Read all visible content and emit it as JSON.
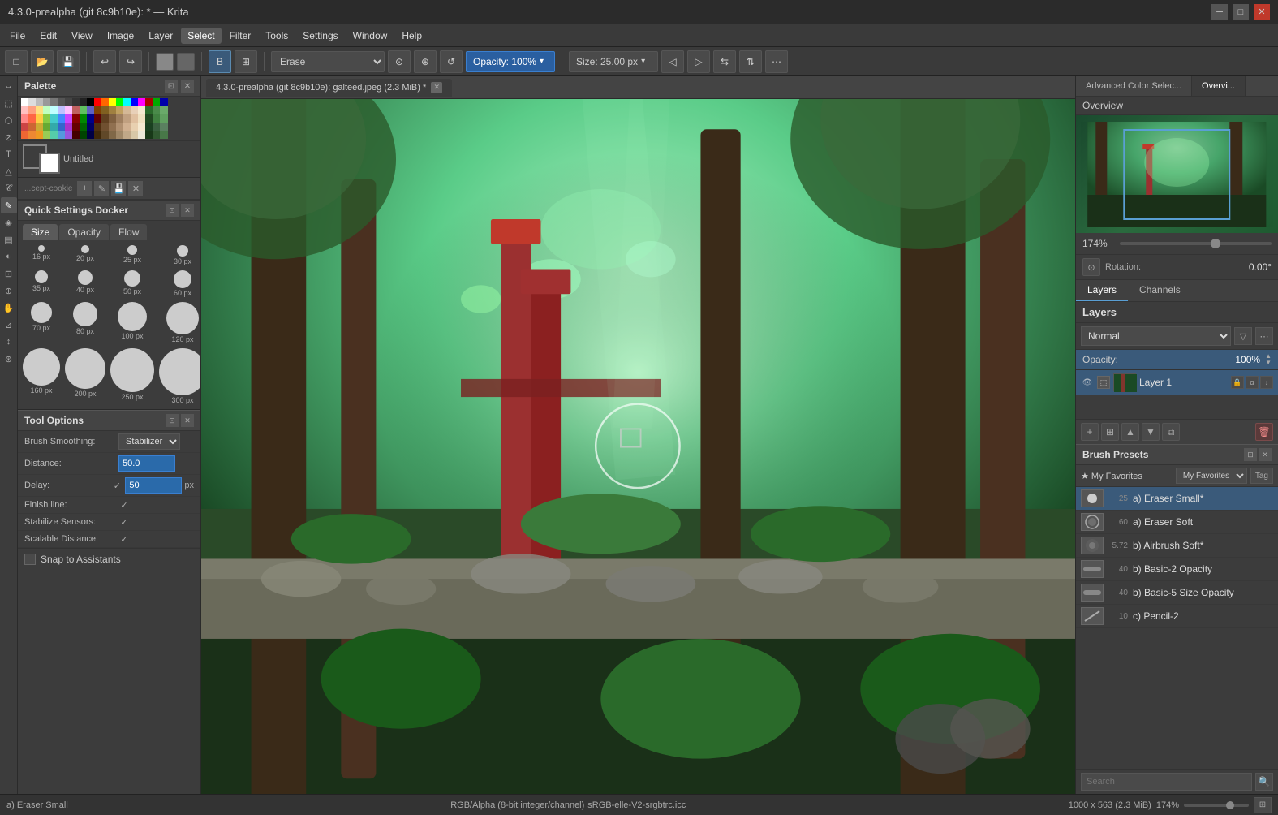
{
  "window": {
    "title": "4.3.0-prealpha (git 8c9b10e): * — Krita",
    "controls": [
      "minimize",
      "maximize",
      "close"
    ]
  },
  "menu": {
    "items": [
      "File",
      "Edit",
      "View",
      "Image",
      "Layer",
      "Select",
      "Filter",
      "Tools",
      "Settings",
      "Window",
      "Help"
    ]
  },
  "toolbar": {
    "erase_label": "Erase",
    "opacity_label": "Opacity: 100%",
    "size_label": "Size: 25.00 px"
  },
  "canvas_tab": {
    "title": "4.3.0-prealpha (git 8c9b10e): galteed.jpeg (2.3 MiB) *"
  },
  "left_panel": {
    "palette_title": "Palette",
    "fg_color": "#3d3d3d",
    "bg_color": "#ffffff",
    "resource_label": "Untitled",
    "resource_sub": "...cept-cookie",
    "quick_settings_title": "Quick Settings Docker",
    "tabs": [
      "Size",
      "Opacity",
      "Flow"
    ],
    "active_tab": "Size",
    "brush_sizes": [
      {
        "size": 8,
        "label": "16 px"
      },
      {
        "size": 10,
        "label": "20 px"
      },
      {
        "size": 12,
        "label": "25 px"
      },
      {
        "size": 14,
        "label": "30 px"
      },
      {
        "size": 16,
        "label": "35 px"
      },
      {
        "size": 18,
        "label": "40 px"
      },
      {
        "size": 20,
        "label": "50 px"
      },
      {
        "size": 22,
        "label": "60 px"
      },
      {
        "size": 26,
        "label": "70 px"
      },
      {
        "size": 30,
        "label": "80 px"
      },
      {
        "size": 36,
        "label": "100 px"
      },
      {
        "size": 40,
        "label": "120 px"
      },
      {
        "size": 46,
        "label": "160 px"
      },
      {
        "size": 50,
        "label": "200 px"
      },
      {
        "size": 54,
        "label": "250 px"
      },
      {
        "size": 58,
        "label": "300 px"
      }
    ],
    "tool_options_title": "Tool Options",
    "brush_smoothing_label": "Brush Smoothing:",
    "brush_smoothing_value": "Stabilizer",
    "distance_label": "Distance:",
    "distance_value": "50.0",
    "delay_label": "Delay:",
    "delay_value": "50",
    "delay_unit": "px",
    "finish_line_label": "Finish line:",
    "finish_line_checked": true,
    "stabilize_sensors_label": "Stabilize Sensors:",
    "stabilize_sensors_checked": true,
    "scalable_distance_label": "Scalable Distance:",
    "scalable_distance_checked": true,
    "snap_assistants_label": "Snap to Assistants"
  },
  "right_panel": {
    "advanced_color_select_tab": "Advanced Color Selec...",
    "overview_tab": "Overvi...",
    "overview_label": "Overview",
    "zoom_percent": "174%",
    "rotation_label": "Rotation:",
    "rotation_value": "0.00°",
    "layers_tab": "Layers",
    "channels_tab": "Channels",
    "layers_title": "Layers",
    "blend_mode": "Normal",
    "opacity_label": "Opacity:",
    "opacity_value": "100%",
    "layer_name": "Layer 1",
    "brush_presets_title": "Brush Presets",
    "favorites_label": "★ My Favorites",
    "tag_label": "Tag",
    "presets": [
      {
        "num": "25",
        "name": "a) Eraser Small*",
        "active": true
      },
      {
        "num": "60",
        "name": "a) Eraser Soft",
        "active": false
      },
      {
        "num": "5.72",
        "name": "b) Airbrush Soft*",
        "active": false
      },
      {
        "num": "40",
        "name": "b) Basic-2 Opacity",
        "active": false
      },
      {
        "num": "40",
        "name": "b) Basic-5 Size Opacity",
        "active": false
      },
      {
        "num": "10",
        "name": "c) Pencil-2",
        "active": false
      }
    ],
    "search_placeholder": "Search",
    "zoom_bottom_percent": "174%"
  },
  "status_bar": {
    "brush_name": "a) Eraser Small",
    "color_mode": "RGB/Alpha (8-bit integer/channel)",
    "color_profile": "sRGB-elle-V2-srgbtrc.icc",
    "dimensions": "1000 x 563 (2.3 MiB)",
    "zoom": "174%"
  },
  "colors": {
    "active_layer_bg": "#3a5a7a",
    "active_preset_bg": "#3a5a7a",
    "opacity_bar_bg": "#2a5fa0",
    "canvas_bg": "#6a6a6a"
  }
}
